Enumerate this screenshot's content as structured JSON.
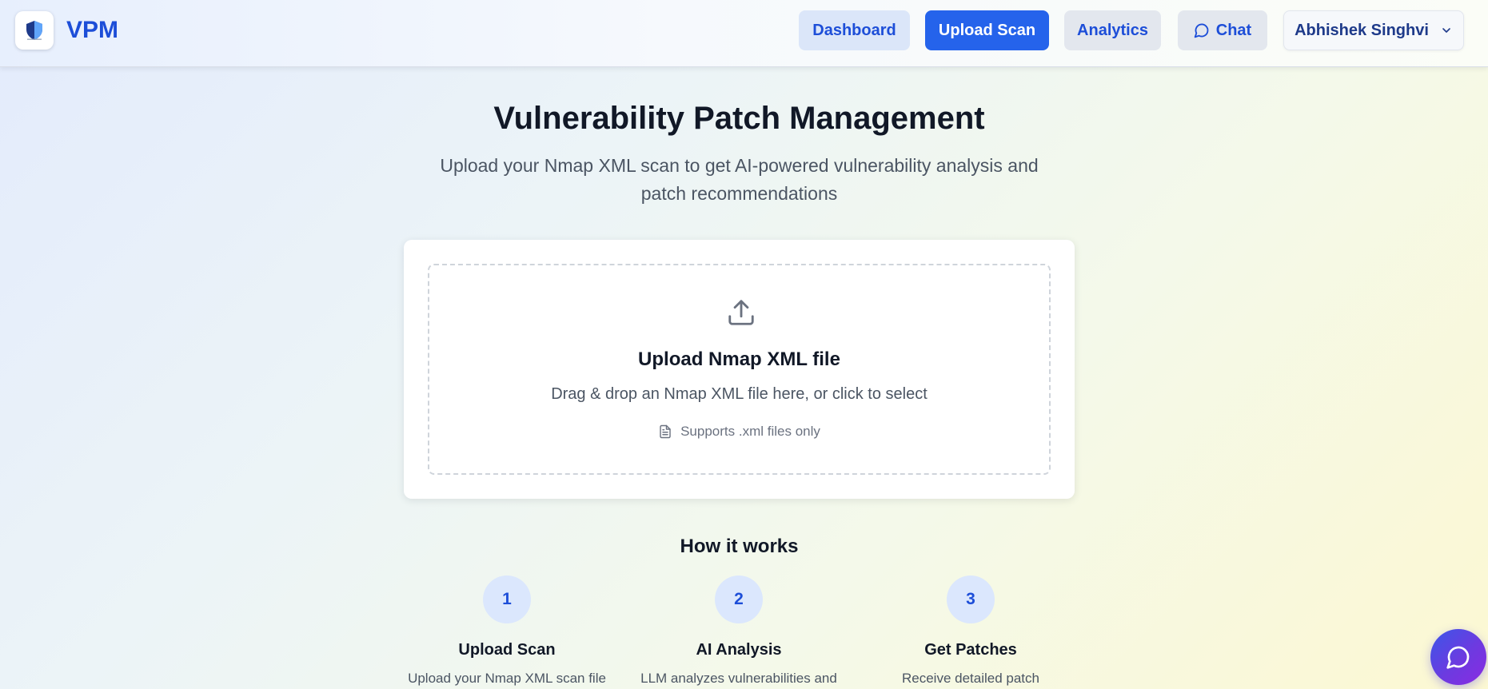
{
  "header": {
    "brand": "VPM",
    "logo_icon": "shield-logo-icon",
    "nav": {
      "dashboard": "Dashboard",
      "upload_scan": "Upload Scan",
      "analytics": "Analytics",
      "chat": "Chat"
    },
    "user": {
      "name": "Abhishek Singhvi"
    },
    "active_nav": "upload_scan"
  },
  "main": {
    "title": "Vulnerability Patch Management",
    "subtitle": "Upload your Nmap XML scan to get AI-powered vulnerability analysis and patch recommendations",
    "upload": {
      "title": "Upload Nmap XML file",
      "description": "Drag & drop an Nmap XML file here, or click to select",
      "note": "Supports .xml files only"
    },
    "how_it_works": {
      "title": "How it works",
      "steps": [
        {
          "number": "1",
          "title": "Upload Scan",
          "description": "Upload your Nmap XML scan file"
        },
        {
          "number": "2",
          "title": "AI Analysis",
          "description": "LLM analyzes vulnerabilities and"
        },
        {
          "number": "3",
          "title": "Get Patches",
          "description": "Receive detailed patch"
        }
      ]
    }
  },
  "colors": {
    "accent": "#2563eb",
    "brand_text": "#1d4ed8",
    "fab_gradient_start": "#3b57e8",
    "fab_gradient_end": "#8a2be2"
  },
  "icons": {
    "chat": "chat-bubble-icon",
    "user_menu": "chevron-down-icon",
    "upload": "upload-icon",
    "file": "file-text-icon",
    "fab": "chat-bubble-icon"
  }
}
